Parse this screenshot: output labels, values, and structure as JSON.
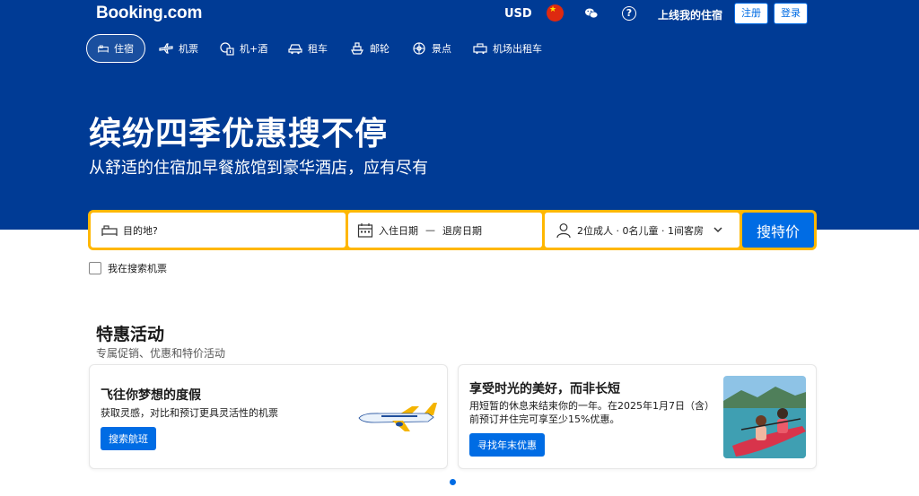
{
  "brand": {
    "logo": "Booking.com",
    "primary_color": "#003b95",
    "accent_color": "#006ce4",
    "highlight_color": "#ffb700"
  },
  "header": {
    "currency": "USD",
    "language_icon": "china-flag-icon",
    "wechat_icon": "wechat-icon",
    "help_icon": "help-icon",
    "list_property": "上线我的住宿",
    "register": "注册",
    "login": "登录"
  },
  "nav": {
    "items": [
      {
        "label": "住宿",
        "icon": "bed-icon",
        "active": true
      },
      {
        "label": "机票",
        "icon": "plane-icon"
      },
      {
        "label": "机+酒",
        "icon": "flight-hotel-icon"
      },
      {
        "label": "租车",
        "icon": "car-icon"
      },
      {
        "label": "邮轮",
        "icon": "ship-icon"
      },
      {
        "label": "景点",
        "icon": "attractions-icon"
      },
      {
        "label": "机场出租车",
        "icon": "taxi-icon"
      }
    ]
  },
  "hero": {
    "title": "缤纷四季优惠搜不停",
    "subtitle": "从舒适的住宿加早餐旅馆到豪华酒店，应有尽有"
  },
  "search": {
    "destination_placeholder": "目的地?",
    "checkin": "入住日期",
    "separator": "—",
    "checkout": "退房日期",
    "guests": "2位成人 · 0名儿童 · 1间客房",
    "button": "搜特价",
    "flight_checkbox_label": "我在搜索机票"
  },
  "offers": {
    "title": "特惠活动",
    "subtitle": "专属促销、优惠和特价活动",
    "cards": [
      {
        "title": "飞往你梦想的度假",
        "description": "获取灵感，对比和预订更具灵活性的机票",
        "button": "搜索航班"
      },
      {
        "title": "享受时光的美好，而非长短",
        "description": "用短暂的休息来结束你的一年。在2025年1月7日（含）前预订并住完可享至少15%优惠。",
        "button": "寻找年末优惠"
      }
    ]
  },
  "carousel": {
    "active_dot": 1
  }
}
